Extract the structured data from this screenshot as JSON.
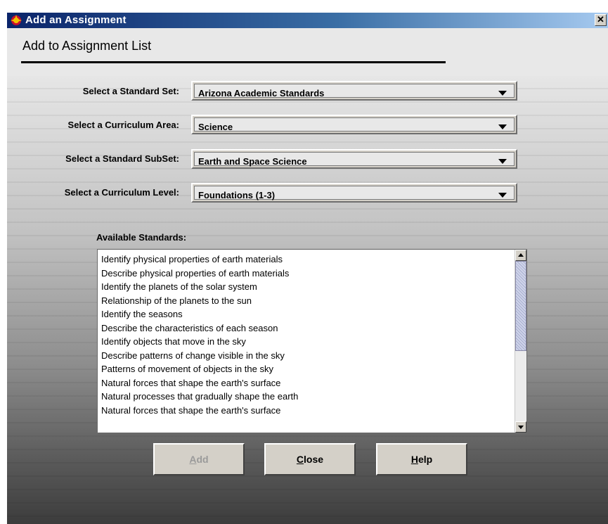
{
  "window": {
    "title": "Add an Assignment",
    "close_glyph": "✕"
  },
  "header": {
    "title": "Add to Assignment List"
  },
  "form": {
    "standard_set": {
      "label": "Select a Standard Set:",
      "value": "Arizona Academic Standards"
    },
    "curriculum_area": {
      "label": "Select a Curriculum Area:",
      "value": "Science"
    },
    "standard_subset": {
      "label": "Select a Standard SubSet:",
      "value": "Earth and Space Science"
    },
    "curriculum_level": {
      "label": "Select a Curriculum Level:",
      "value": "Foundations (1-3)"
    }
  },
  "standards": {
    "label": "Available Standards:",
    "items": [
      "Identify physical properties of earth materials",
      "Describe physical properties of earth materials",
      "Identify the planets of the solar system",
      "Relationship of the planets to the sun",
      "Identify the seasons",
      "Describe the characteristics of each season",
      "Identify objects that move in the sky",
      "Describe patterns of change visible in the sky",
      "Patterns of movement of objects in the sky",
      "Natural forces that shape the earth's surface",
      "Natural processes that gradually shape the earth",
      "Natural forces that shape the earth's surface"
    ]
  },
  "buttons": {
    "add": {
      "mnemonic": "A",
      "rest": "dd",
      "enabled": false
    },
    "close": {
      "mnemonic": "C",
      "rest": "lose",
      "enabled": true
    },
    "help": {
      "mnemonic": "H",
      "rest": "elp",
      "enabled": true
    }
  },
  "colors": {
    "titlebar_start": "#0a246a",
    "titlebar_end": "#a6caf0",
    "button_face": "#d4d0c8",
    "disabled_text": "#9a9a9a"
  },
  "icons": {
    "app": "app-icon",
    "close": "close-icon",
    "dropdown": "chevron-down-icon",
    "scroll_up": "scroll-up-icon",
    "scroll_down": "scroll-down-icon"
  }
}
